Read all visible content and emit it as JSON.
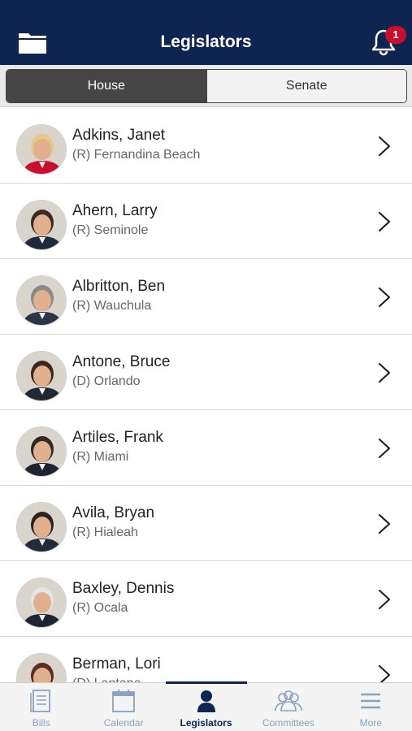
{
  "header": {
    "title": "Legislators",
    "notification_count": "1"
  },
  "segments": {
    "house": "House",
    "senate": "Senate"
  },
  "legislators": [
    {
      "name": "Adkins, Janet",
      "district": "(R) Fernandina Beach",
      "hair": "#e4c889",
      "shirt": "#c8102e"
    },
    {
      "name": "Ahern, Larry",
      "district": "(R) Seminole",
      "hair": "#3a2a22",
      "shirt": "#1e2a3c"
    },
    {
      "name": "Albritton, Ben",
      "district": "(R) Wauchula",
      "hair": "#8a8a8a",
      "shirt": "#2a3548"
    },
    {
      "name": "Antone, Bruce",
      "district": "(D) Orlando",
      "hair": "#3a2720",
      "shirt": "#222833"
    },
    {
      "name": "Artiles, Frank",
      "district": "(R) Miami",
      "hair": "#2f2a27",
      "shirt": "#1e2530"
    },
    {
      "name": "Avila, Bryan",
      "district": "(R) Hialeah",
      "hair": "#2b2320",
      "shirt": "#222a37"
    },
    {
      "name": "Baxley, Dennis",
      "district": "(R) Ocala",
      "hair": "#e5e5e5",
      "shirt": "#1d2533"
    },
    {
      "name": "Berman, Lori",
      "district": "(D) Lantana",
      "hair": "#5a2e23",
      "shirt": "#a33a4a"
    }
  ],
  "tabs": [
    {
      "label": "Bills",
      "icon": "bills-icon"
    },
    {
      "label": "Calendar",
      "icon": "calendar-icon"
    },
    {
      "label": "Legislators",
      "icon": "person-icon"
    },
    {
      "label": "Committees",
      "icon": "group-icon"
    },
    {
      "label": "More",
      "icon": "menu-icon"
    }
  ],
  "colors": {
    "header_bg": "#0d2550",
    "badge": "#c8102e",
    "tab_inactive": "#8aa1c0",
    "tab_active": "#0d2550"
  }
}
